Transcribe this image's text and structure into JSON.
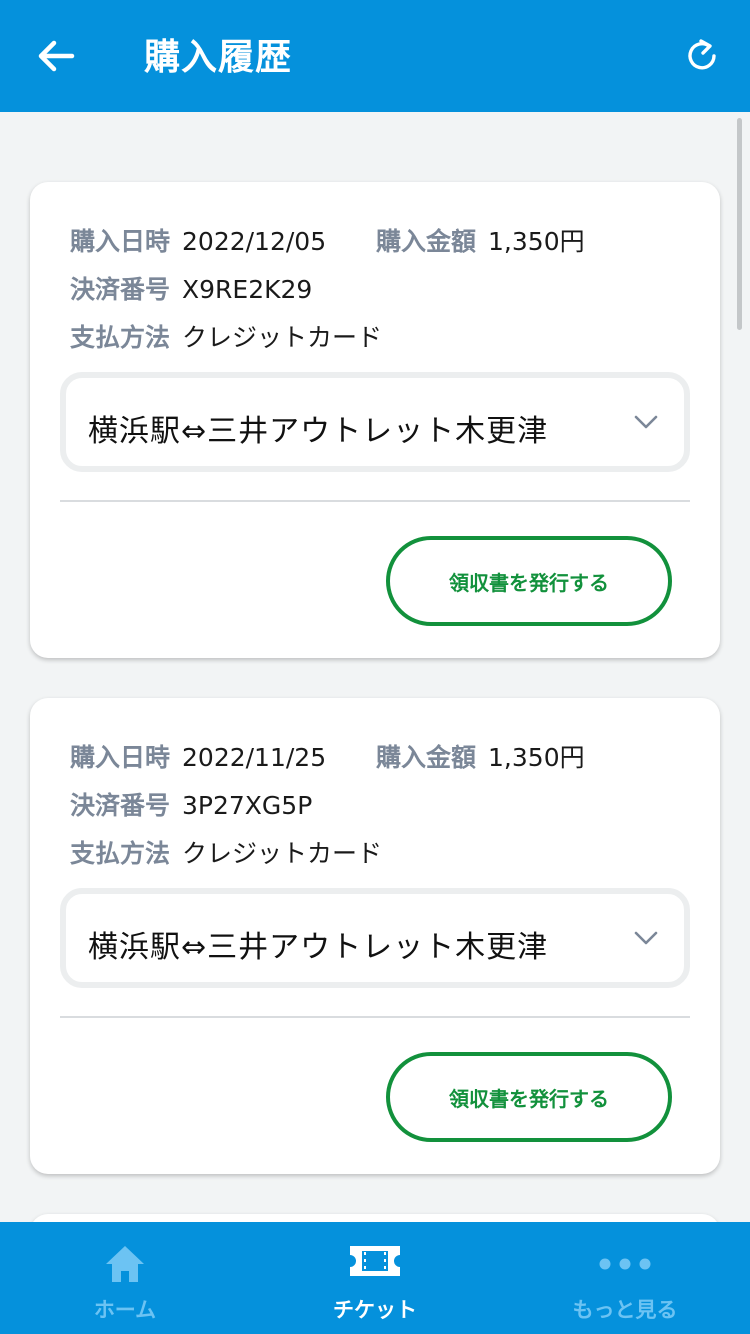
{
  "header": {
    "title": "購入履歴",
    "back_icon": "arrow-left-icon",
    "refresh_icon": "refresh-icon",
    "color": "#0591dc"
  },
  "purchases": [
    {
      "date_label": "購入日時",
      "date": "2022/12/05",
      "amount_label": "購入金額",
      "amount": "1,350円",
      "payment_no_label": "決済番号",
      "payment_no": "X9RE2K29",
      "method_label": "支払方法",
      "method": "クレジットカード",
      "route": "横浜駅⇔三井アウトレット木更津",
      "receipt_button": "領収書を発行する"
    },
    {
      "date_label": "購入日時",
      "date": "2022/11/25",
      "amount_label": "購入金額",
      "amount": "1,350円",
      "payment_no_label": "決済番号",
      "payment_no": "3P27XG5P",
      "method_label": "支払方法",
      "method": "クレジットカード",
      "route": "横浜駅⇔三井アウトレット木更津",
      "receipt_button": "領収書を発行する"
    }
  ],
  "bottom_nav": {
    "items": [
      {
        "label": "ホーム",
        "icon": "home-icon",
        "active": false
      },
      {
        "label": "チケット",
        "icon": "ticket-icon",
        "active": true
      },
      {
        "label": "もっと見る",
        "icon": "more-dots-icon",
        "active": false
      }
    ]
  },
  "colors": {
    "accent": "#0591dc",
    "button_green": "#12913c",
    "label_gray": "#7b8798",
    "nav_inactive": "#6cc3f3"
  }
}
